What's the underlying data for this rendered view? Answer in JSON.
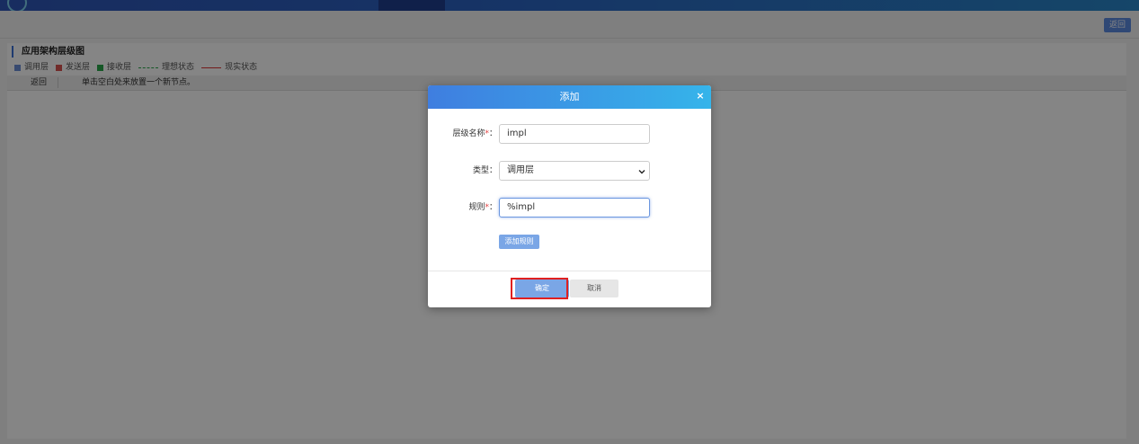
{
  "header": {
    "back_label": "返回"
  },
  "panel": {
    "title": "应用架构层级图",
    "legend": [
      {
        "label": "调用层",
        "color": "#6b8fd6",
        "kind": "square"
      },
      {
        "label": "发送层",
        "color": "#d9534f",
        "kind": "square"
      },
      {
        "label": "接收层",
        "color": "#2aa84a",
        "kind": "square"
      },
      {
        "label": "理想状态",
        "color": "#2aa84a",
        "kind": "dashed-line"
      },
      {
        "label": "现实状态",
        "color": "#d33333",
        "kind": "solid-line"
      }
    ],
    "subbar": {
      "back_label": "返回",
      "hint": "单击空白处来放置一个新节点。"
    }
  },
  "modal": {
    "title": "添加",
    "close_symbol": "×",
    "fields": {
      "level_name": {
        "label": "层级名称",
        "required_mark": "*",
        "suffix": "：",
        "value": "impl"
      },
      "type": {
        "label": "类型",
        "suffix": "：",
        "value": "调用层"
      },
      "rule": {
        "label": "规则",
        "required_mark": "*",
        "suffix": "：",
        "value": "%impl"
      }
    },
    "add_rule_label": "添加规则",
    "ok_label": "确定",
    "cancel_label": "取消"
  },
  "colors": {
    "accent": "#3f7ee0",
    "highlight": "#e02020"
  }
}
